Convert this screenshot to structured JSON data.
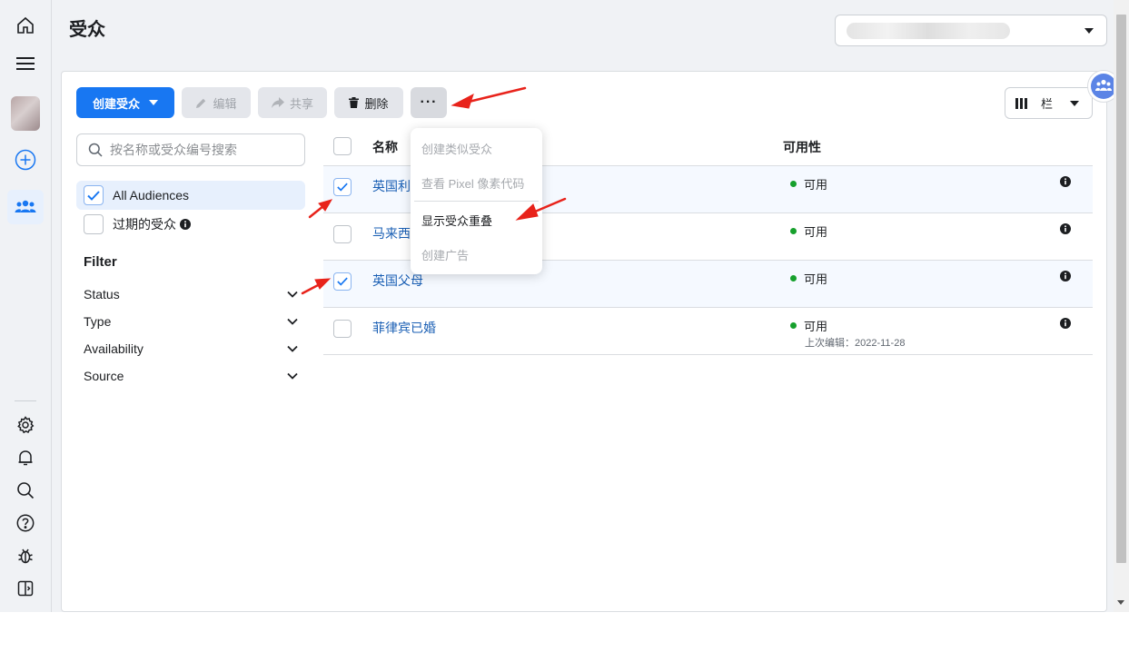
{
  "page": {
    "title": "受众"
  },
  "toolbar": {
    "create_label": "创建受众",
    "edit_label": "编辑",
    "share_label": "共享",
    "delete_label": "删除",
    "more_label": "···",
    "columns_label": "栏"
  },
  "search": {
    "placeholder": "按名称或受众编号搜索"
  },
  "audience_filter": {
    "all_label": "All Audiences",
    "expired_label": "过期的受众"
  },
  "filter": {
    "title": "Filter",
    "items": [
      {
        "label": "Status"
      },
      {
        "label": "Type"
      },
      {
        "label": "Availability"
      },
      {
        "label": "Source"
      }
    ]
  },
  "table": {
    "col_name": "名称",
    "col_availability": "可用性",
    "rows": [
      {
        "name": "英国利",
        "status": "可用",
        "selected": true,
        "sub": ""
      },
      {
        "name": "马来西",
        "status": "可用",
        "selected": false,
        "sub": ""
      },
      {
        "name": "英国父母",
        "status": "可用",
        "selected": true,
        "sub": ""
      },
      {
        "name": "菲律宾已婚",
        "status": "可用",
        "selected": false,
        "sub": "上次编辑：2022-11-28"
      }
    ]
  },
  "more_menu": {
    "items": [
      {
        "label": "创建类似受众",
        "enabled": false
      },
      {
        "label": "查看 Pixel 像素代码",
        "enabled": false
      },
      {
        "label": "显示受众重叠",
        "enabled": true
      },
      {
        "label": "创建广告",
        "enabled": false
      }
    ]
  },
  "colors": {
    "accent": "#1877f2",
    "status_ok": "#16a02c",
    "annotation": "#e8231b"
  }
}
